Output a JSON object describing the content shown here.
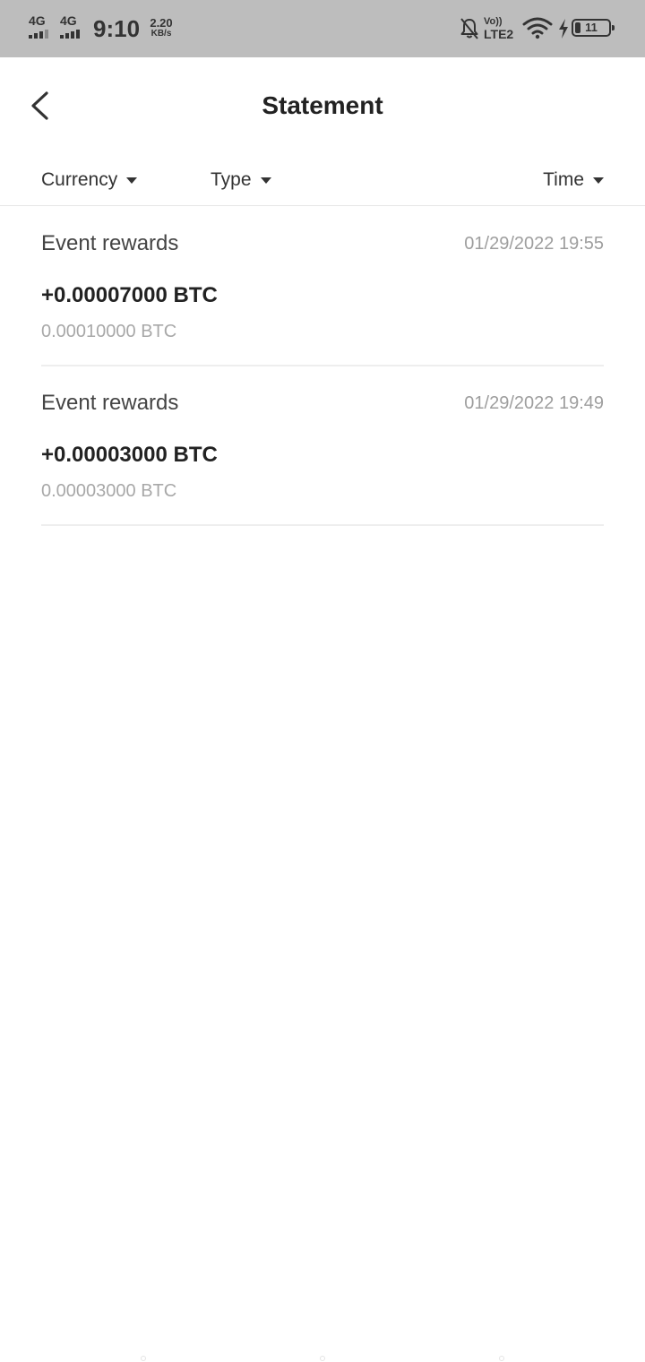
{
  "status_bar": {
    "network1": "4G",
    "network2": "4G",
    "time": "9:10",
    "speed_value": "2.20",
    "speed_unit": "KB/s",
    "volte_top": "Vo))",
    "volte_bottom": "LTE2",
    "battery": "11",
    "icons": [
      "signal-icon",
      "bell-off-icon",
      "wifi-icon",
      "charging-icon",
      "battery-icon"
    ]
  },
  "header": {
    "title": "Statement",
    "back_icon": "chevron-left-icon"
  },
  "filters": {
    "currency": "Currency",
    "type": "Type",
    "time": "Time"
  },
  "items": [
    {
      "type": "Event rewards",
      "time": "01/29/2022 19:55",
      "amount": "+0.00007000 BTC",
      "balance": "0.00010000 BTC"
    },
    {
      "type": "Event rewards",
      "time": "01/29/2022 19:49",
      "amount": "+0.00003000 BTC",
      "balance": "0.00003000 BTC"
    }
  ],
  "colors": {
    "status_bar_bg": "#bdbdbd",
    "text_primary": "#222222",
    "text_muted": "#9e9e9e",
    "divider": "#eeeeee"
  }
}
